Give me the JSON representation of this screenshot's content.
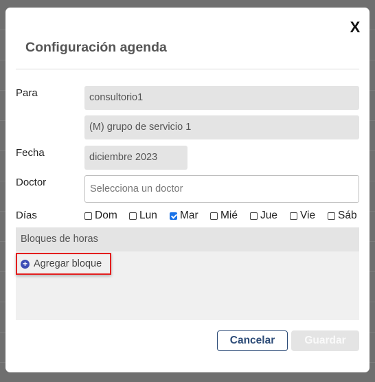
{
  "dialog": {
    "title": "Configuración agenda",
    "close_label": "X"
  },
  "form": {
    "para_label": "Para",
    "para_value": "consultorio1",
    "service_value": "(M) grupo de servicio 1",
    "fecha_label": "Fecha",
    "fecha_value": "diciembre 2023",
    "doctor_label": "Doctor",
    "doctor_placeholder": "Selecciona un doctor",
    "dias_label": "Días",
    "days": [
      {
        "label": "Dom",
        "checked": false
      },
      {
        "label": "Lun",
        "checked": false
      },
      {
        "label": "Mar",
        "checked": true
      },
      {
        "label": "Mié",
        "checked": false
      },
      {
        "label": "Jue",
        "checked": false
      },
      {
        "label": "Vie",
        "checked": false
      },
      {
        "label": "Sáb",
        "checked": false
      }
    ]
  },
  "blocks": {
    "header": "Bloques de horas",
    "add_label": "Agregar bloque"
  },
  "footer": {
    "cancel_label": "Cancelar",
    "save_label": "Guardar"
  },
  "colors": {
    "primary": "#2c4b77",
    "highlight": "#e31e1e",
    "checkbox": "#1a73e8",
    "add_icon": "#3d4db5"
  }
}
